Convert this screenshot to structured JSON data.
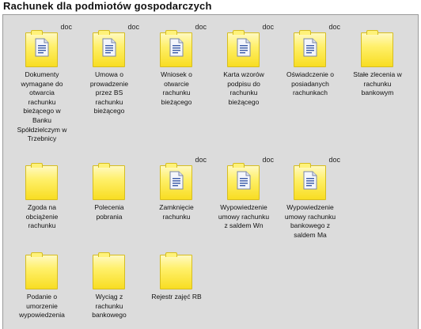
{
  "title": "Rachunek dla podmiotów gospodarczych",
  "items": [
    {
      "label": "Dokumenty\nwymagane do\notwarcia\nrachunku\nbieżącego w\nBanku\nSpółdzielczym w\nTrzebnicy",
      "tag": "doc",
      "has_doc": true
    },
    {
      "label": "Umowa o\nprowadzenie\nprzez BS\nrachunku\nbieżącego",
      "tag": "doc",
      "has_doc": true
    },
    {
      "label": "Wniosek o\notwarcie\nrachunku\nbieżącego",
      "tag": "doc",
      "has_doc": true
    },
    {
      "label": "Karta wzorów\npodpisu do\nrachunku\nbieżącego",
      "tag": "doc",
      "has_doc": true
    },
    {
      "label": "Oświadczenie o\nposiadanych\nrachunkach",
      "tag": "doc",
      "has_doc": true
    },
    {
      "label": "Stałe zlecenia w\nrachunku\nbankowym",
      "tag": "",
      "has_doc": false
    },
    {
      "label": "Zgoda na\nobciążenie\nrachunku",
      "tag": "",
      "has_doc": false
    },
    {
      "label": "Polecenia\npobrania",
      "tag": "",
      "has_doc": false
    },
    {
      "label": "Zamknięcie\nrachunku",
      "tag": "doc",
      "has_doc": true
    },
    {
      "label": "Wypowiedzenie\numowy rachunku\nz saldem Wn",
      "tag": "doc",
      "has_doc": true
    },
    {
      "label": "Wypowiedzenie\numowy rachunku\nbankowego z\nsaldem Ma",
      "tag": "doc",
      "has_doc": true
    },
    {
      "label": "Podanie o\numorzenie\nwypowiedzenia",
      "tag": "",
      "has_doc": false
    },
    {
      "label": "Wyciąg z\nrachunku\nbankowego",
      "tag": "",
      "has_doc": false
    },
    {
      "label": "Rejestr zajęć RB",
      "tag": "",
      "has_doc": false
    }
  ],
  "colors": {
    "panel": "#dcdcdc",
    "folder": "#fff06a",
    "folder_border": "#d6bd20"
  }
}
